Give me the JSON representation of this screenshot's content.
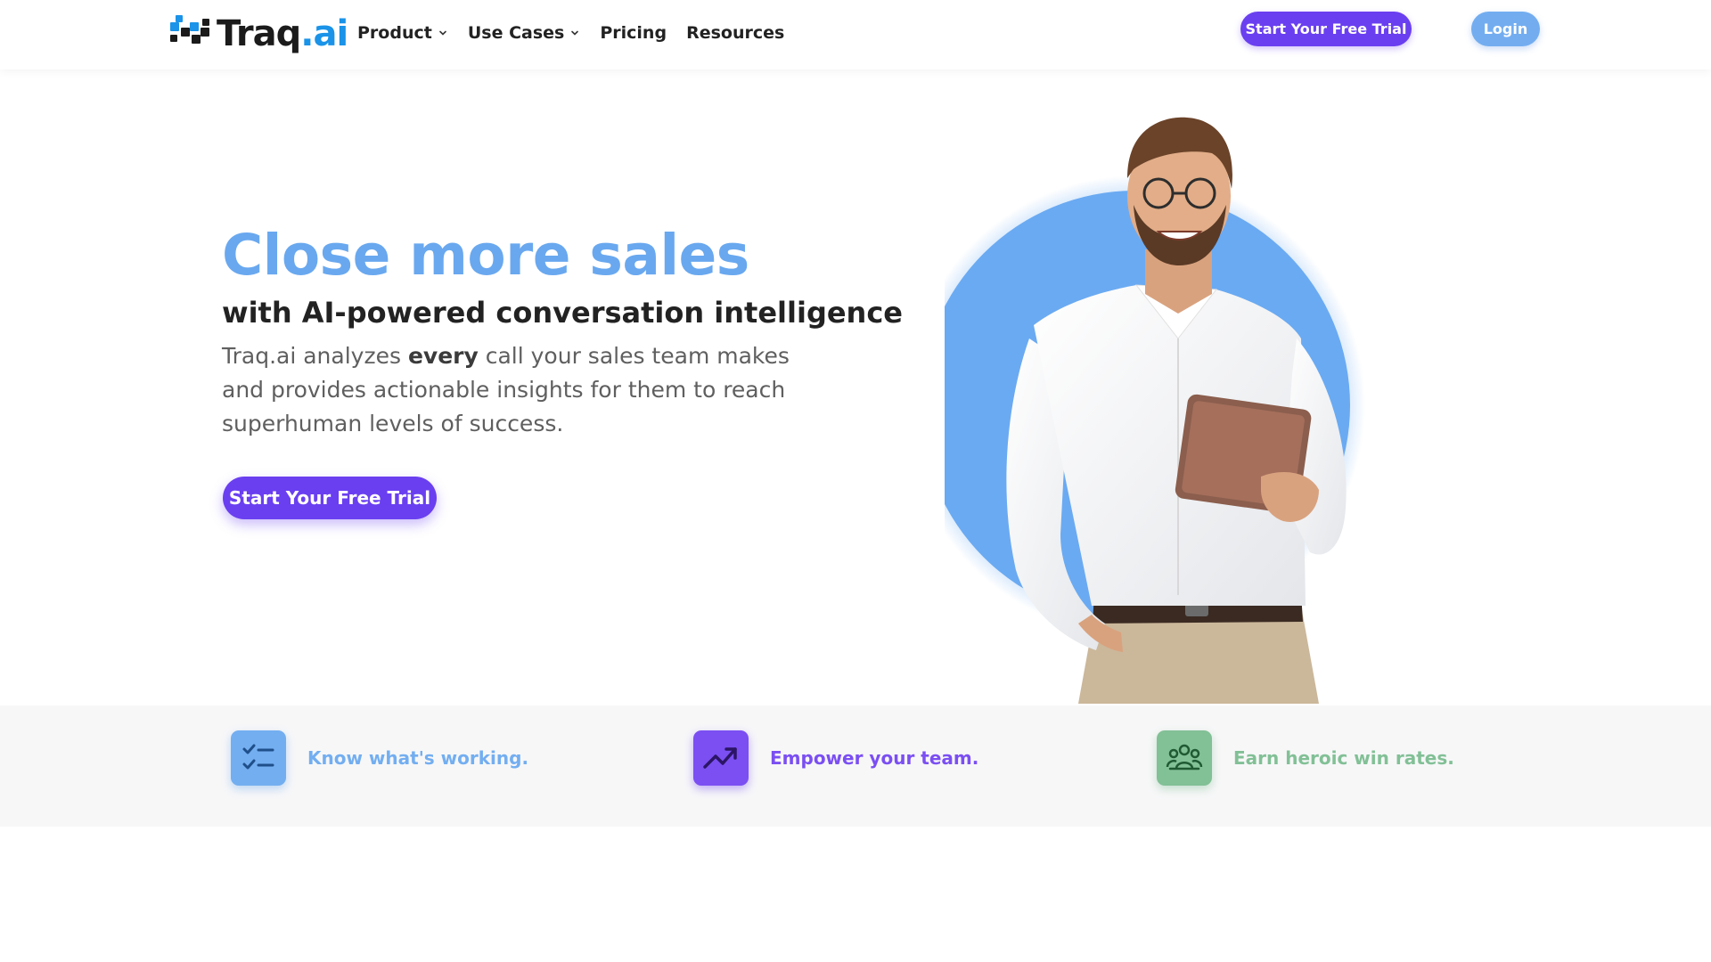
{
  "header": {
    "logo": {
      "text_part1": "Traq",
      "text_part2": ".ai"
    },
    "nav": [
      {
        "label": "Product",
        "has_dropdown": true
      },
      {
        "label": "Use Cases",
        "has_dropdown": true
      },
      {
        "label": "Pricing",
        "has_dropdown": false
      },
      {
        "label": "Resources",
        "has_dropdown": false
      }
    ],
    "cta_label": "Start Your Free Trial",
    "login_label": "Login"
  },
  "hero": {
    "title": "Close more sales",
    "subtitle": "with AI-powered conversation intelligence",
    "desc_before": "Traq.ai analyzes ",
    "desc_bold": "every",
    "desc_after": " call your sales team makes and provides actionable insights for them to reach superhuman levels of success.",
    "cta_label": "Start Your Free Trial"
  },
  "features": [
    {
      "label": "Know what's working.",
      "icon": "checklist-icon",
      "color": "#73aef0"
    },
    {
      "label": "Empower your team.",
      "icon": "trending-up-icon",
      "color": "#7b4ff2"
    },
    {
      "label": "Earn heroic win rates.",
      "icon": "team-icon",
      "color": "#82c096"
    }
  ],
  "colors": {
    "accent_purple": "#6a3ff0",
    "accent_blue": "#69a8ef",
    "logo_blue": "#1a93e8",
    "strip_bg": "#f7f7f8"
  }
}
